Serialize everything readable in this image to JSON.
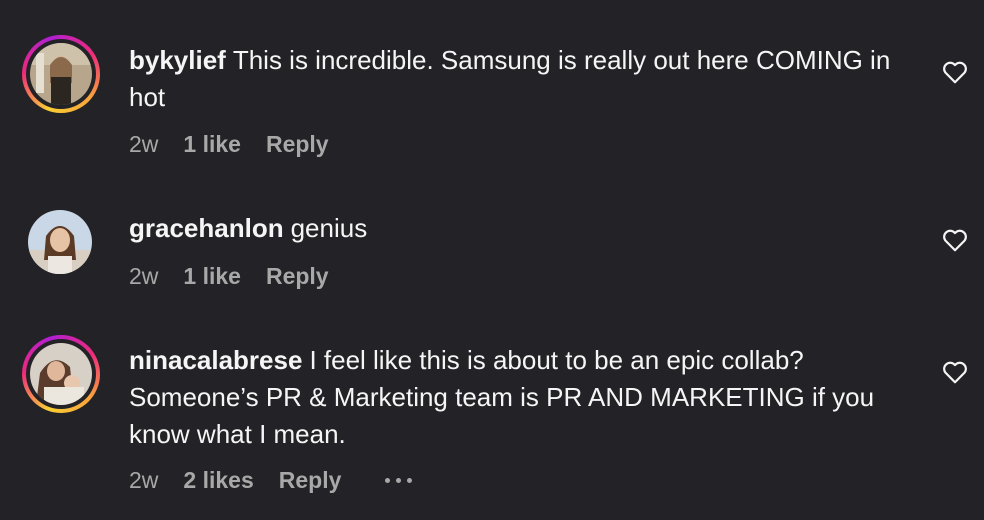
{
  "comments": [
    {
      "username": "bykylief",
      "text": "This is incredible. Samsung is really out here COMING in hot",
      "age": "2w",
      "likes": "1 like",
      "reply": "Reply"
    },
    {
      "username": "gracehanlon",
      "text": "genius",
      "age": "2w",
      "likes": "1 like",
      "reply": "Reply"
    },
    {
      "username": "ninacalabrese",
      "text": "I feel like this is about to be an epic collab? Someone’s PR & Marketing team is PR AND MARKETING if you know what I mean.",
      "age": "2w",
      "likes": "2 likes",
      "reply": "Reply"
    }
  ],
  "icons": {
    "like": "heart-outline-icon",
    "more": "more-horizontal-icon"
  },
  "colors": {
    "background": "#232327",
    "text": "#f5f5f5",
    "secondary_text": "#a8a8a8",
    "story_ring": [
      "#f9ce34",
      "#ee2a7b",
      "#b01fd3"
    ]
  }
}
